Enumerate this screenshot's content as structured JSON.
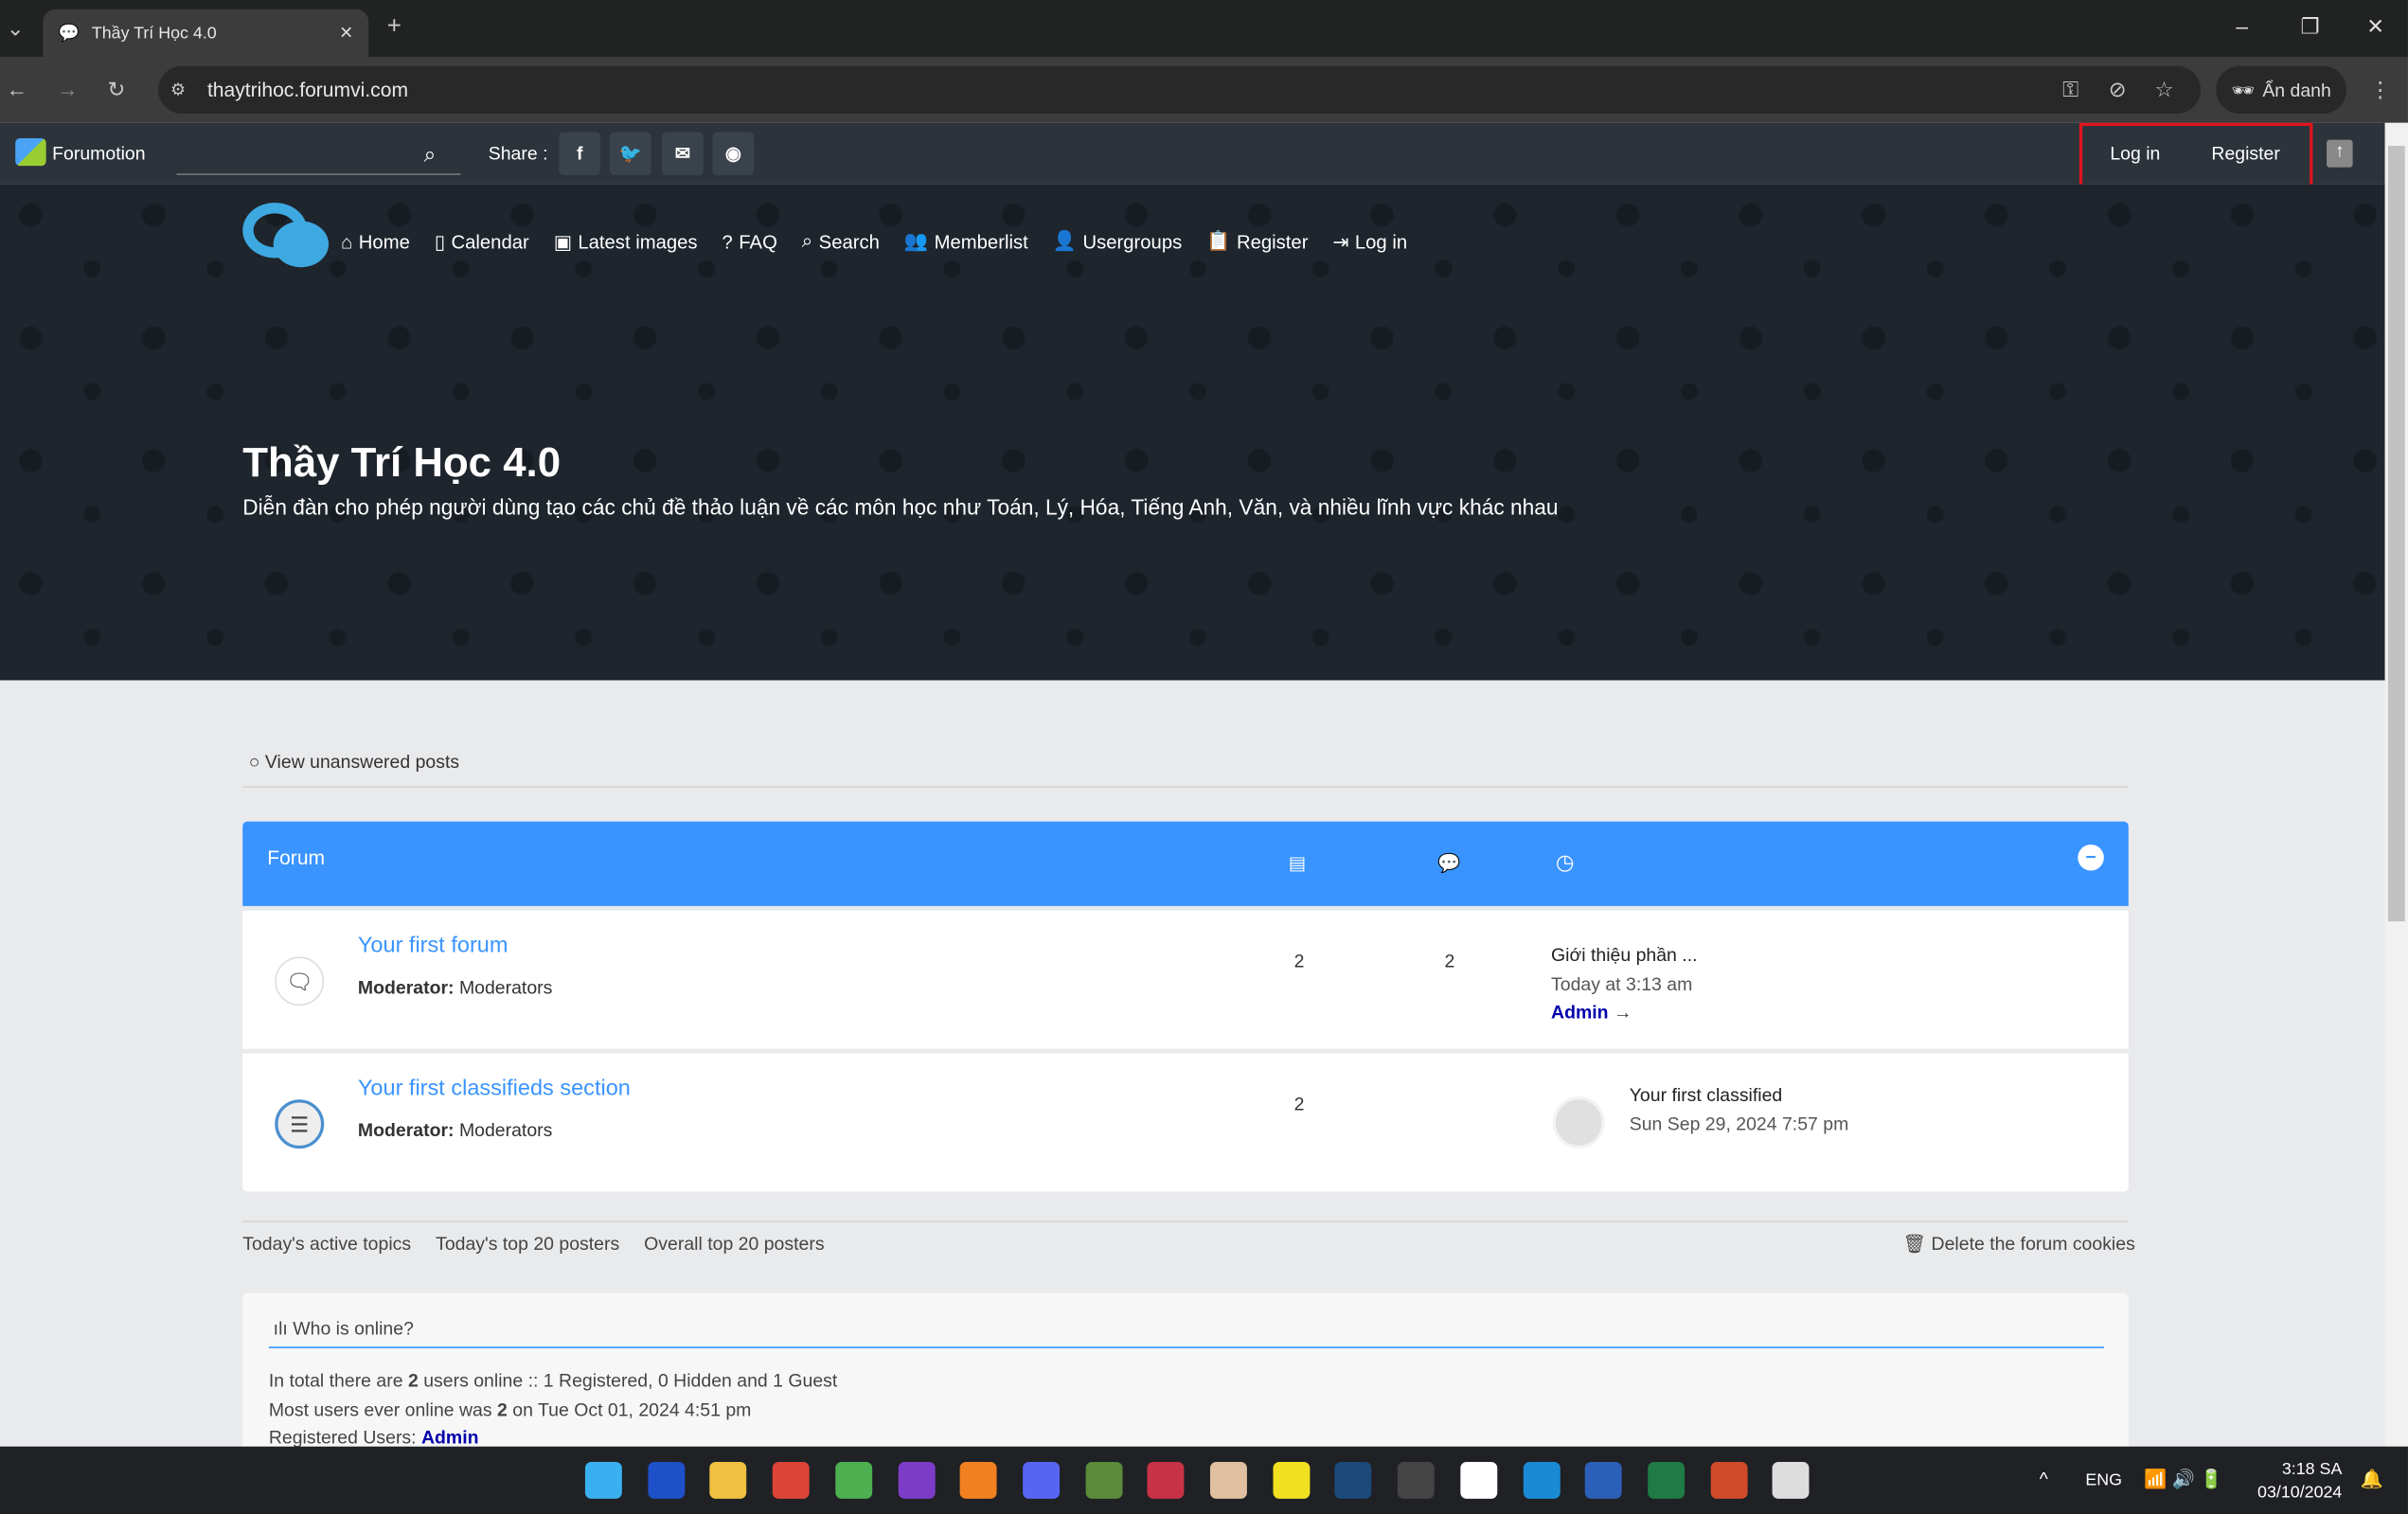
{
  "browser": {
    "tab_title": "Thầy Trí Học 4.0",
    "url": "thaytrihoc.forumvi.com",
    "incognito_label": "Ẩn danh"
  },
  "topbar": {
    "brand": "Forumotion",
    "share_label": "Share :",
    "login": "Log in",
    "register": "Register"
  },
  "nav": [
    {
      "icon": "home-icon",
      "label": "Home"
    },
    {
      "icon": "calendar-icon",
      "label": "Calendar"
    },
    {
      "icon": "image-icon",
      "label": "Latest images"
    },
    {
      "icon": "question-icon",
      "label": "FAQ"
    },
    {
      "icon": "search-icon",
      "label": "Search"
    },
    {
      "icon": "members-icon",
      "label": "Memberlist"
    },
    {
      "icon": "usergroups-icon",
      "label": "Usergroups"
    },
    {
      "icon": "clipboard-icon",
      "label": "Register"
    },
    {
      "icon": "login-icon",
      "label": "Log in"
    }
  ],
  "hero": {
    "title": "Thầy Trí Học 4.0",
    "subtitle": "Diễn đàn cho phép người dùng tạo các chủ đề thảo luận về các môn học như Toán, Lý, Hóa, Tiếng Anh, Văn, và nhiều lĩnh vực khác nhau"
  },
  "unanswered": "View unanswered posts",
  "forum": {
    "header": "Forum",
    "rows": [
      {
        "title": "Your first forum",
        "mod_label": "Moderator:",
        "mod": "Moderators",
        "topics": "2",
        "posts": "2",
        "last_title": "Giới thiệu phần ...",
        "last_date": "Today at 3:13 am",
        "last_user": "Admin",
        "arrow": "→"
      },
      {
        "title": "Your first classifieds section",
        "mod_label": "Moderator:",
        "mod": "Moderators",
        "topics": "2",
        "last_title": "Your first classified",
        "last_date": "Sun Sep 29, 2024 7:57 pm"
      }
    ]
  },
  "links": [
    "Today's active topics",
    "Today's top 20 posters",
    "Overall top 20 posters"
  ],
  "delete_cookies": "Delete the forum cookies",
  "online": {
    "title": "Who is online?",
    "l1a": "In total there are ",
    "l1b": "2",
    "l1c": " users online :: 1 Registered, 0 Hidden and 1 Guest",
    "l2a": "Most users ever online was ",
    "l2b": "2",
    "l2c": " on Tue Oct 01, 2024 4:51 pm",
    "l3a": "Registered Users: ",
    "l3b": "Admin"
  },
  "system": {
    "lang": "ENG",
    "time": "3:18 SA",
    "date": "03/10/2024"
  },
  "colors": {
    "accent": "#3994ff",
    "user": "#0000aa"
  }
}
